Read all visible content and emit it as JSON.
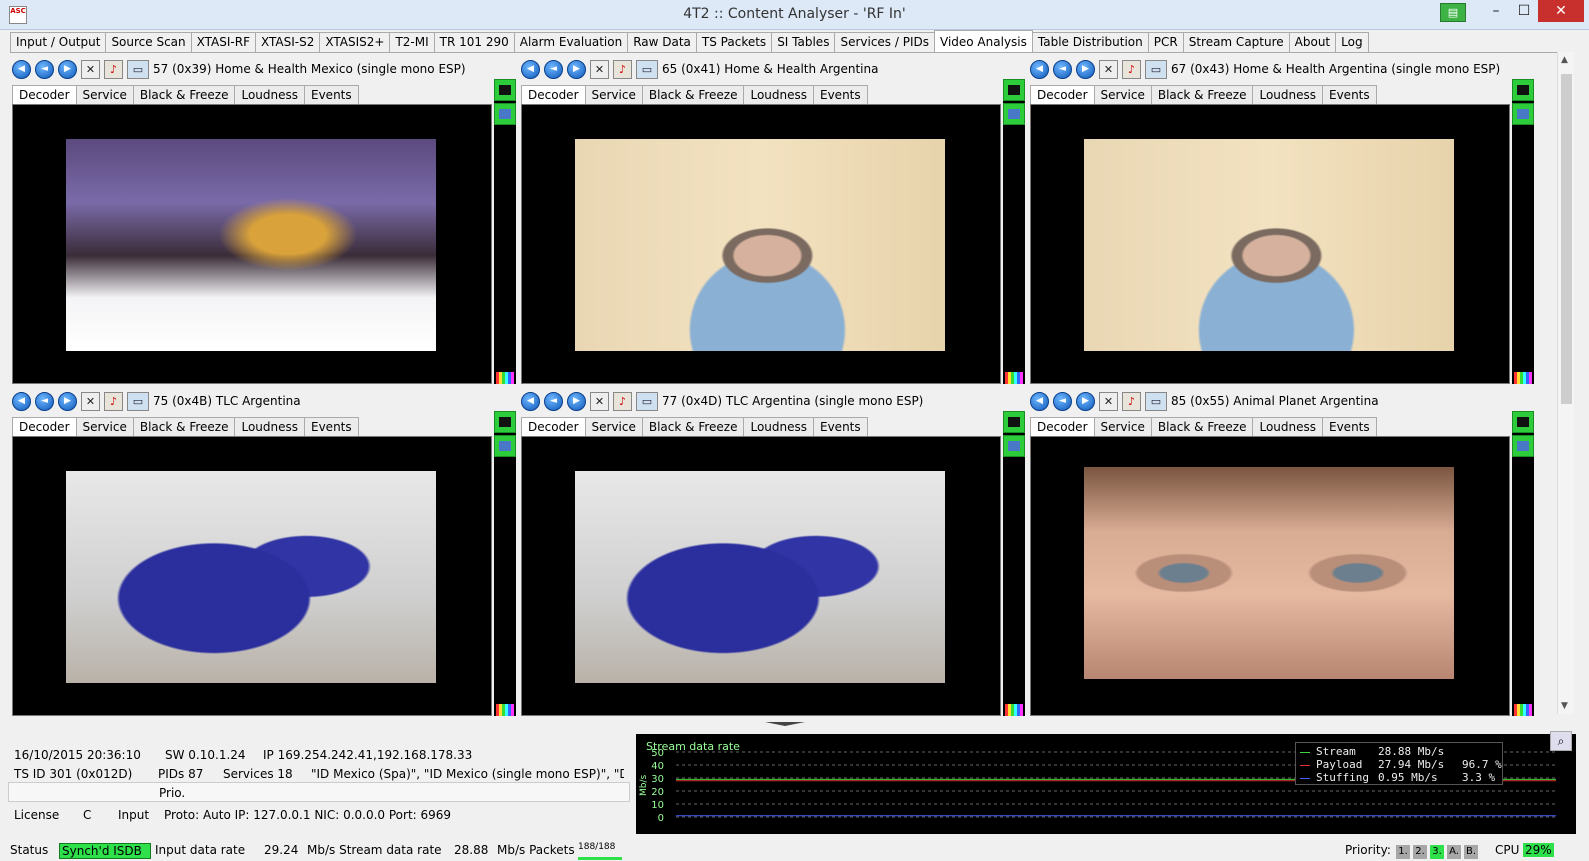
{
  "window": {
    "title": "4T2 :: Content Analyser - 'RF In'"
  },
  "tabs": [
    "Input / Output",
    "Source Scan",
    "XTASI-RF",
    "XTASI-S2",
    "XTASIS2+",
    "T2-MI",
    "TR 101 290",
    "Alarm Evaluation",
    "Raw Data",
    "TS Packets",
    "SI Tables",
    "Services / PIDs",
    "Video Analysis",
    "Table Distribution",
    "PCR",
    "Stream Capture",
    "About",
    "Log"
  ],
  "active_tab": "Video Analysis",
  "subtabs": [
    "Decoder",
    "Service",
    "Black & Freeze",
    "Loudness",
    "Events"
  ],
  "panels": [
    {
      "title": "57 (0x39) Home & Health Mexico (single mono ESP)"
    },
    {
      "title": "65 (0x41) Home & Health Argentina"
    },
    {
      "title": "67 (0x43) Home & Health Argentina (single mono ESP)"
    },
    {
      "title": "75 (0x4B) TLC Argentina"
    },
    {
      "title": "77 (0x4D) TLC Argentina (single mono ESP)"
    },
    {
      "title": "85 (0x55) Animal Planet Argentina"
    }
  ],
  "info": {
    "datetime": "16/10/2015 20:36:10",
    "sw": "SW  0.10.1.24",
    "ip": "IP  169.254.242.41,192.168.178.33",
    "tsid": "TS ID  301 (0x012D)",
    "pids": "PIDs  87",
    "services": "Services  18",
    "service_names": "\"ID Mexico (Spa)\", \"ID Mexico (single mono ESP)\", \"Dis",
    "prio": "Prio.",
    "license_label": "License",
    "license_val": "C",
    "input_label": "Input",
    "input_val": "Proto: Auto IP: 127.0.0.1 NIC: 0.0.0.0 Port: 6969"
  },
  "chart_data": {
    "type": "line",
    "title": "Stream data rate",
    "ylabel": "Mb/s",
    "ylim": [
      0,
      50
    ],
    "yticks": [
      0,
      10,
      20,
      30,
      40,
      50
    ],
    "grid": true,
    "legend": [
      {
        "label": "Stream",
        "value": "28.88 Mb/s",
        "pct": "",
        "color": "#3dd43d"
      },
      {
        "label": "Payload",
        "value": "27.94 Mb/s",
        "pct": "96.7 %",
        "color": "#e03030"
      },
      {
        "label": "Stuffing",
        "value": "0.95 Mb/s",
        "pct": "3.3 %",
        "color": "#4060ff"
      }
    ],
    "series": [
      {
        "name": "Stream",
        "values": [
          28.9,
          28.9,
          28.9,
          28.9,
          28.9,
          28.9,
          28.9,
          28.9,
          28.9,
          28.9
        ]
      },
      {
        "name": "Payload",
        "values": [
          27.9,
          27.9,
          27.9,
          27.9,
          27.9,
          27.9,
          27.9,
          27.9,
          27.9,
          27.9
        ]
      },
      {
        "name": "Stuffing",
        "values": [
          0.95,
          0.95,
          0.95,
          0.95,
          0.95,
          0.95,
          0.95,
          0.95,
          0.95,
          0.95
        ]
      }
    ]
  },
  "status": {
    "label": "Status",
    "synch": "Synch'd ISDB",
    "input_rate_label": "Input data rate",
    "input_rate": "29.24",
    "stream_rate_label": "Mb/s Stream data rate",
    "stream_rate": "28.88",
    "packets_label": "Mb/s Packets",
    "packets": "188/188",
    "priority_label": "Priority:",
    "priority": [
      "1.",
      "2.",
      "3.",
      "A.",
      "B."
    ],
    "priority_active": "3.",
    "cpu_label": "CPU",
    "cpu": "29%"
  },
  "colors": {
    "accent": "#2ee04a",
    "title_bar": "#dde9f7",
    "close": "#c7302c"
  }
}
